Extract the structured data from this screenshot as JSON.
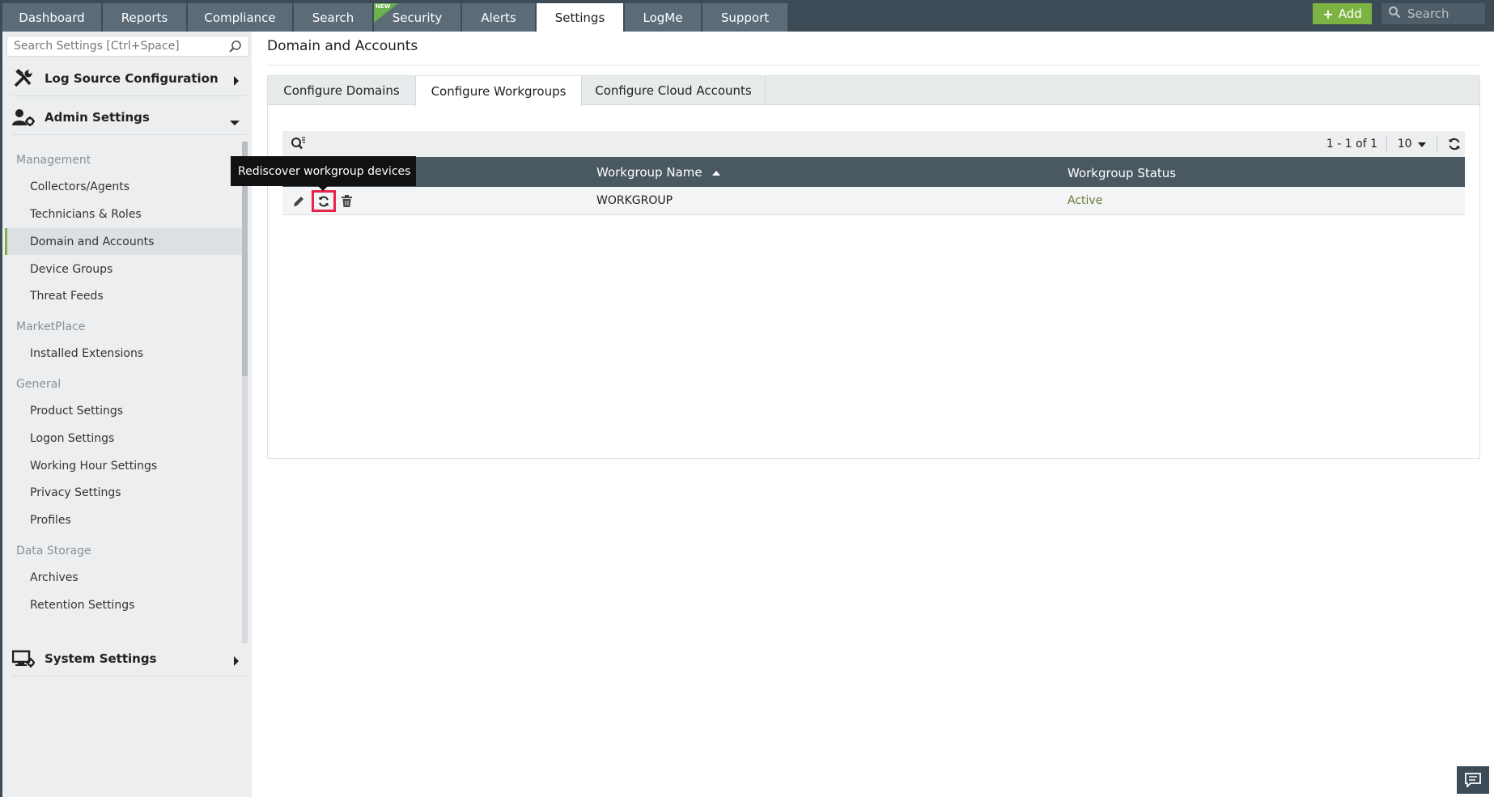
{
  "topnav": {
    "tabs": [
      {
        "label": "Dashboard"
      },
      {
        "label": "Reports"
      },
      {
        "label": "Compliance"
      },
      {
        "label": "Search"
      },
      {
        "label": "Security",
        "badge": "NEW"
      },
      {
        "label": "Alerts"
      },
      {
        "label": "Settings",
        "active": true
      },
      {
        "label": "LogMe"
      },
      {
        "label": "Support"
      }
    ],
    "add_label": "Add",
    "search_placeholder": "Search"
  },
  "sidebar": {
    "search_placeholder": "Search Settings [Ctrl+Space]",
    "sections": {
      "log_source": "Log Source Configuration",
      "admin": "Admin Settings",
      "system": "System Settings"
    },
    "groups": {
      "management": "Management",
      "marketplace": "MarketPlace",
      "general": "General",
      "data_storage": "Data Storage"
    },
    "items": {
      "collectors": "Collectors/Agents",
      "technicians": "Technicians & Roles",
      "domain_accounts": "Domain and Accounts",
      "device_groups": "Device Groups",
      "threat_feeds": "Threat Feeds",
      "installed_extensions": "Installed Extensions",
      "product_settings": "Product Settings",
      "logon_settings": "Logon Settings",
      "working_hour": "Working Hour Settings",
      "privacy": "Privacy Settings",
      "profiles": "Profiles",
      "archives": "Archives",
      "retention": "Retention Settings"
    },
    "active_item": "Domain and Accounts"
  },
  "main": {
    "title": "Domain and Accounts",
    "subtabs": {
      "domains": "Configure Domains",
      "workgroups": "Configure Workgroups",
      "cloud": "Configure Cloud Accounts"
    },
    "active_subtab": "Configure Workgroups",
    "pager": "1 - 1 of 1",
    "per_page": "10",
    "columns": {
      "name": "Workgroup Name",
      "status": "Workgroup Status"
    },
    "rows": [
      {
        "name": "WORKGROUP",
        "status": "Active"
      }
    ],
    "tooltip": "Rediscover workgroup devices"
  },
  "colors": {
    "nav_bg": "#3d4b56",
    "accent_green": "#7cb342",
    "highlight_red": "#e8234d",
    "status_active": "#6b7a3a"
  }
}
